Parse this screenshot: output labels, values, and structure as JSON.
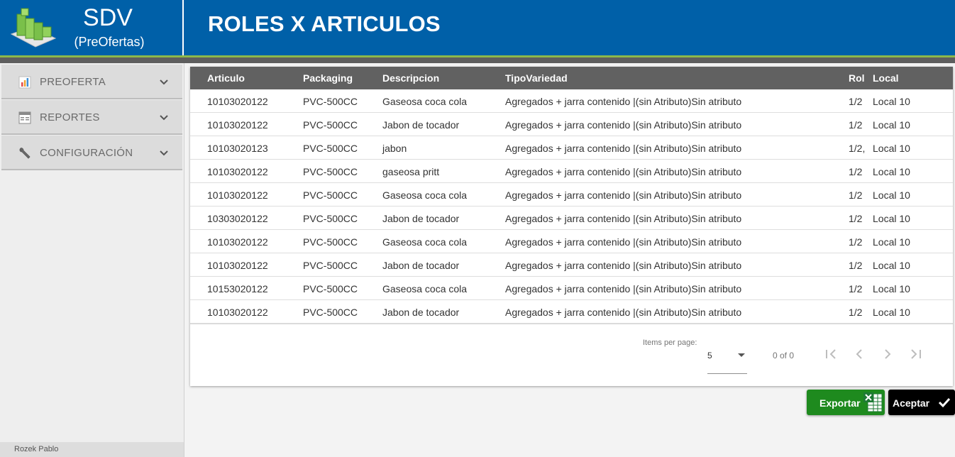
{
  "brand": {
    "title": "SDV",
    "subtitle": "(PreOfertas)"
  },
  "page": {
    "title": "ROLES X ARTICULOS"
  },
  "sidebar": {
    "items": [
      {
        "label": "PREOFERTA",
        "icon": "bar-chart-icon"
      },
      {
        "label": "REPORTES",
        "icon": "report-icon"
      },
      {
        "label": "CONFIGURACIÓN",
        "icon": "wrench-icon"
      }
    ],
    "user": "Rozek Pablo"
  },
  "table": {
    "columns": [
      "Articulo",
      "Packaging",
      "Descripcion",
      "TipoVariedad",
      "Rol",
      "Local"
    ],
    "rows": [
      [
        "10103020122",
        "PVC-500CC",
        "Gaseosa coca cola",
        "Agregados + jarra contenido |(sin Atributo)Sin atributo",
        "1/2",
        "Local 10"
      ],
      [
        "10103020122",
        "PVC-500CC",
        "Jabon de tocador",
        "Agregados + jarra contenido |(sin Atributo)Sin atributo",
        "1/2",
        "Local 10"
      ],
      [
        "10103020123",
        "PVC-500CC",
        "jabon",
        "Agregados + jarra contenido |(sin Atributo)Sin atributo",
        "1/2,",
        "Local 10"
      ],
      [
        "10103020122",
        "PVC-500CC",
        "gaseosa pritt",
        "Agregados + jarra contenido |(sin Atributo)Sin atributo",
        "1/2",
        "Local 10"
      ],
      [
        "10103020122",
        "PVC-500CC",
        "Gaseosa coca cola",
        "Agregados + jarra contenido |(sin Atributo)Sin atributo",
        "1/2",
        "Local 10"
      ],
      [
        "10303020122",
        "PVC-500CC",
        "Jabon de tocador",
        "Agregados + jarra contenido |(sin Atributo)Sin atributo",
        "1/2",
        "Local 10"
      ],
      [
        "10103020122",
        "PVC-500CC",
        "Gaseosa coca cola",
        "Agregados + jarra contenido |(sin Atributo)Sin atributo",
        "1/2",
        "Local 10"
      ],
      [
        "10103020122",
        "PVC-500CC",
        "Jabon de tocador",
        "Agregados + jarra contenido |(sin Atributo)Sin atributo",
        "1/2",
        "Local 10"
      ],
      [
        "10153020122",
        "PVC-500CC",
        "Gaseosa coca cola",
        "Agregados + jarra contenido |(sin Atributo)Sin atributo",
        "1/2",
        "Local 10"
      ],
      [
        "10103020122",
        "PVC-500CC",
        "Jabon de tocador",
        "Agregados + jarra contenido |(sin Atributo)Sin atributo",
        "1/2",
        "Local 10"
      ]
    ]
  },
  "paginator": {
    "items_per_page_label": "Items per page:",
    "items_per_page_value": "5",
    "range_label": "0 of 0"
  },
  "actions": {
    "export_label": "Exportar",
    "accept_label": "Aceptar"
  },
  "colors": {
    "header_blue": "#0060a8",
    "accent_green": "#8cb84a",
    "table_header": "#616161",
    "export_green": "#1e8a1e",
    "accept_black": "#000000"
  }
}
